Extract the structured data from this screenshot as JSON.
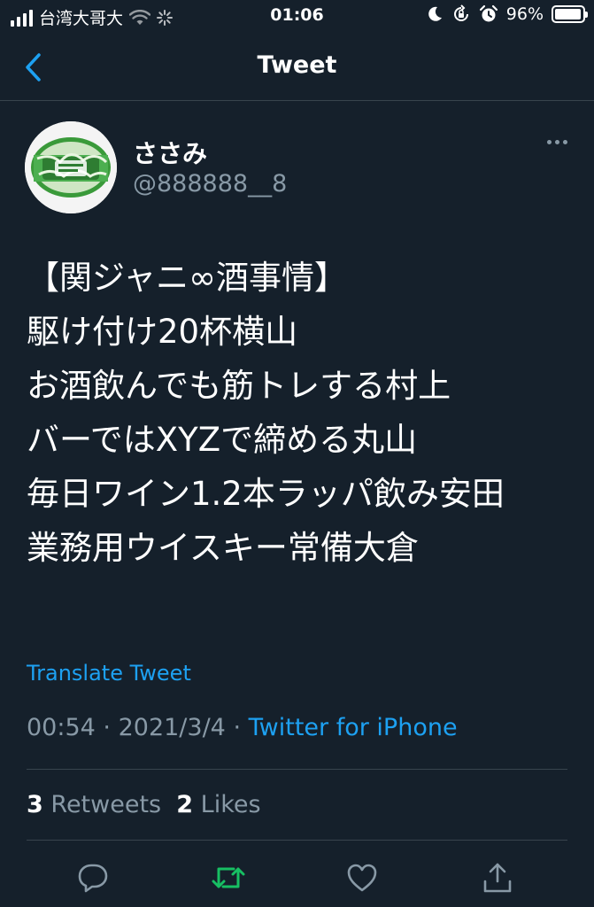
{
  "status_bar": {
    "carrier": "台湾大哥大",
    "time": "01:06",
    "battery_percent": "96%",
    "battery_level": 0.96
  },
  "nav": {
    "title": "Tweet"
  },
  "tweet": {
    "author": {
      "display_name": "ささみ",
      "handle": "@888888__8"
    },
    "text": "【関ジャニ∞酒事情】\n駆け付け20杯横山\nお酒飲んでも筋トレする村上\nバーではXYZで締める丸山\n毎日ワイン1.2本ラッパ飲み安田\n業務用ウイスキー常備大倉",
    "translate_label": "Translate Tweet",
    "time": "00:54",
    "separator": "·",
    "date": "2021/3/4",
    "source": "Twitter for iPhone",
    "retweets_count": "3",
    "retweets_label": "Retweets",
    "likes_count": "2",
    "likes_label": "Likes"
  },
  "actions": {
    "icons": [
      "reply-icon",
      "retweet-icon",
      "like-icon",
      "share-icon"
    ],
    "retweet_color": "#17bf63"
  },
  "colors": {
    "background": "#15202b",
    "secondary_text": "#8899a6",
    "accent": "#1da1f2",
    "divider": "#38444d"
  }
}
